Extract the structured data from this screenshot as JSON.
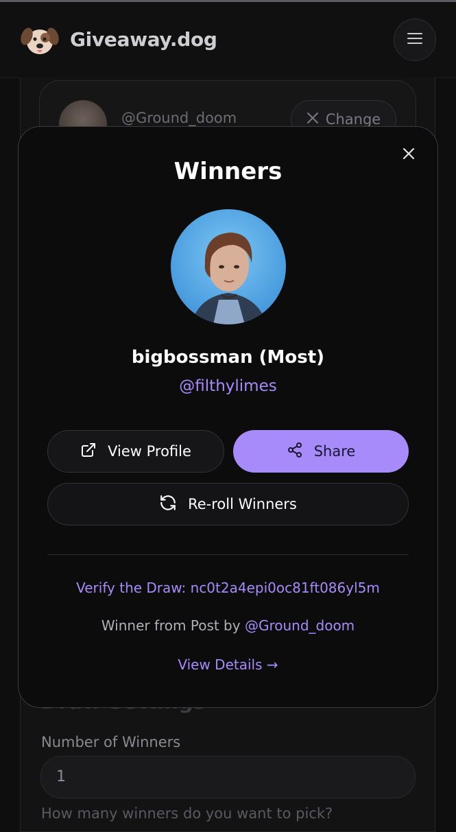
{
  "header": {
    "brand": "Giveaway.dog",
    "logo_icon": "dog-face-icon",
    "menu_icon": "hamburger-menu-icon"
  },
  "background": {
    "selected_user": "@Ground_doom",
    "change_label": "Change",
    "section_title": "Draw Settings",
    "winners_label": "Number of Winners",
    "winners_value": "1",
    "winners_hint": "How many winners do you want to pick?"
  },
  "modal": {
    "title": "Winners",
    "winner_name": "bigbossman (Most)",
    "winner_handle": "@filthylimes",
    "view_profile_label": "View Profile",
    "share_label": "Share",
    "reroll_label": "Re-roll Winners",
    "verify_text": "Verify the Draw: nc0t2a4epi0oc81ft086yl5m",
    "from_post_prefix": "Winner from Post by",
    "from_post_user": "@Ground_doom",
    "view_details_label": "View Details →"
  },
  "colors": {
    "accent": "#a78bfa",
    "background": "#0e0e0f",
    "modal_bg": "#0c0c0d"
  }
}
